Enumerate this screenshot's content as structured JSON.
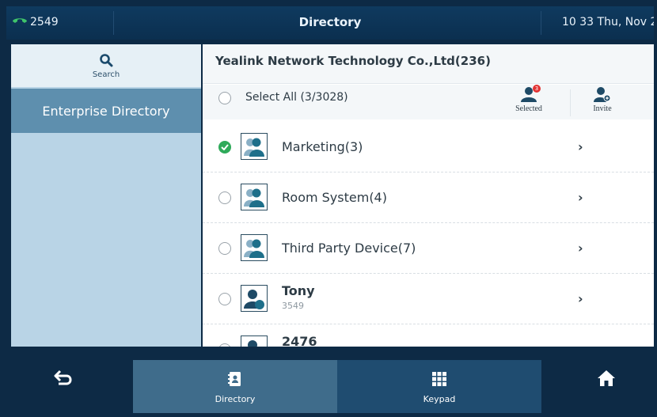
{
  "statusbar": {
    "account": "2549",
    "title": "Directory",
    "clock": "10 33 Thu, Nov 2"
  },
  "sidebar": {
    "search_label": "Search",
    "items": [
      {
        "label": "Enterprise Directory",
        "active": true
      }
    ]
  },
  "directory": {
    "organization": "Yealink Network Technology Co.,Ltd(236)",
    "select_all": "Select All (3/3028)",
    "selected_label": "Selected",
    "selected_badge": "3",
    "invite_label": "Invite",
    "rows": [
      {
        "name": "Marketing(3)",
        "type": "group",
        "checked": true
      },
      {
        "name": "Room System(4)",
        "type": "group",
        "checked": false
      },
      {
        "name": "Third Party Device(7)",
        "type": "group",
        "checked": false
      },
      {
        "name": "Tony",
        "number": "3549",
        "type": "contact",
        "checked": false
      },
      {
        "name": "2476",
        "number": "2476",
        "type": "contact",
        "checked": false
      }
    ]
  },
  "bottombar": {
    "directory_label": "Directory",
    "keypad_label": "Keypad"
  },
  "colors": {
    "accent": "#5e8fae",
    "check": "#2faa5a",
    "badge": "#e23232",
    "bar": "#0d2a45"
  }
}
